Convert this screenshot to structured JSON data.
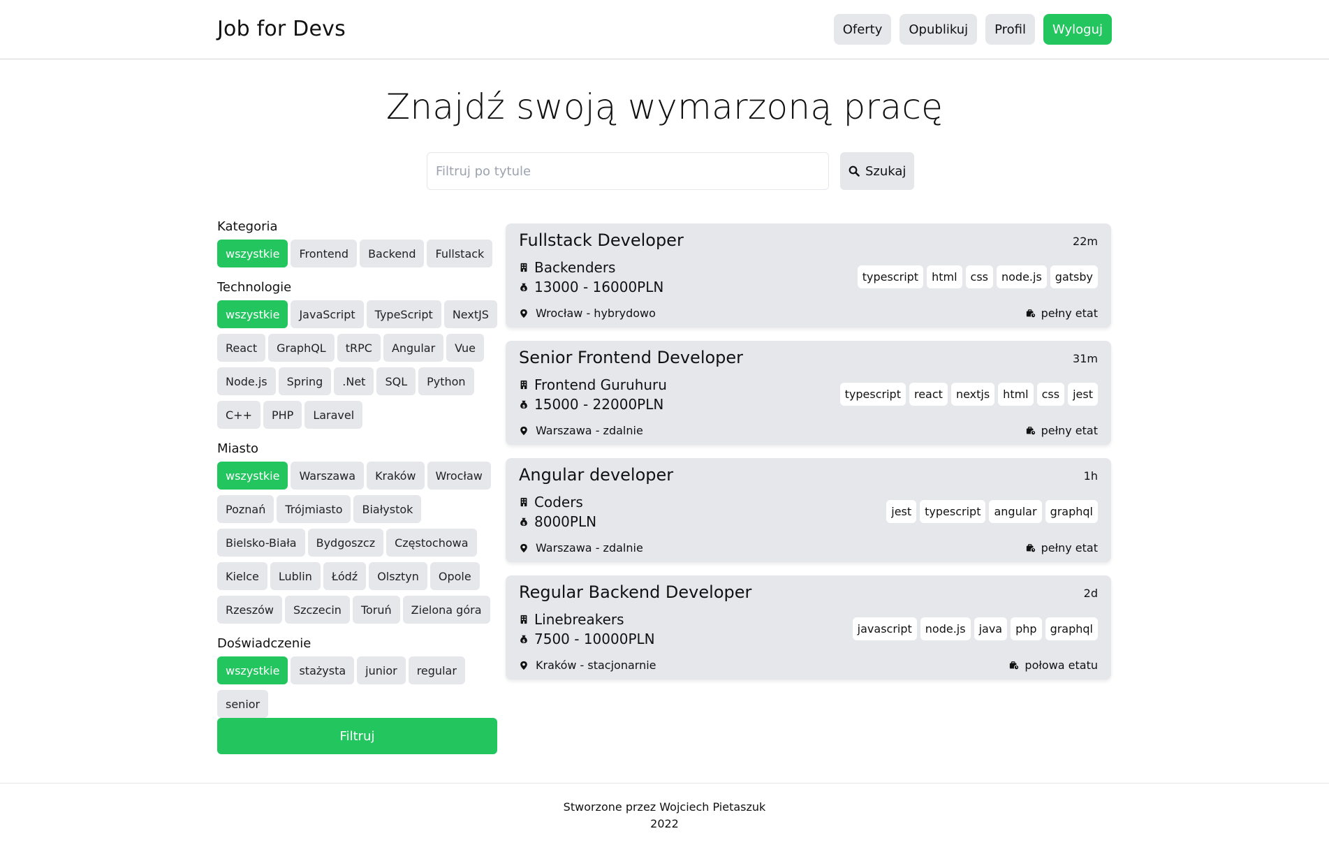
{
  "header": {
    "brand": "Job for Devs",
    "nav": [
      {
        "label": "Oferty",
        "name": "nav-oferty-button"
      },
      {
        "label": "Opublikuj",
        "name": "nav-opublikuj-button"
      },
      {
        "label": "Profil",
        "name": "nav-profil-button"
      },
      {
        "label": "Wyloguj",
        "name": "nav-wyloguj-button"
      }
    ]
  },
  "hero": {
    "title": "Znajdź swoją wymarzoną pracę"
  },
  "search": {
    "placeholder": "Filtruj po tytule",
    "value": "",
    "button_label": "Szukaj"
  },
  "filters": {
    "category": {
      "heading": "Kategoria",
      "options": [
        "wszystkie",
        "Frontend",
        "Backend",
        "Fullstack"
      ],
      "selected": "wszystkie"
    },
    "technology": {
      "heading": "Technologie",
      "options": [
        "wszystkie",
        "JavaScript",
        "TypeScript",
        "NextJS",
        "React",
        "GraphQL",
        "tRPC",
        "Angular",
        "Vue",
        "Node.js",
        "Spring",
        ".Net",
        "SQL",
        "Python",
        "C++",
        "PHP",
        "Laravel"
      ],
      "selected": "wszystkie"
    },
    "city": {
      "heading": "Miasto",
      "options": [
        "wszystkie",
        "Warszawa",
        "Kraków",
        "Wrocław",
        "Poznań",
        "Trójmiasto",
        "Białystok",
        "Bielsko-Biała",
        "Bydgoszcz",
        "Częstochowa",
        "Kielce",
        "Lublin",
        "Łódź",
        "Olsztyn",
        "Opole",
        "Rzeszów",
        "Szczecin",
        "Toruń",
        "Zielona góra"
      ],
      "selected": "wszystkie"
    },
    "experience": {
      "heading": "Doświadczenie",
      "options": [
        "wszystkie",
        "stażysta",
        "junior",
        "regular",
        "senior"
      ],
      "selected": "wszystkie"
    },
    "submit_label": "Filtruj"
  },
  "jobs": [
    {
      "title": "Fullstack Developer",
      "age": "22m",
      "company": "Backenders",
      "salary": "13000 - 16000PLN",
      "location": "Wrocław - hybrydowo",
      "employment": "pełny etat",
      "tags": [
        "typescript",
        "html",
        "css",
        "node.js",
        "gatsby"
      ]
    },
    {
      "title": "Senior Frontend Developer",
      "age": "31m",
      "company": "Frontend Guruhuru",
      "salary": "15000 - 22000PLN",
      "location": "Warszawa - zdalnie",
      "employment": "pełny etat",
      "tags": [
        "typescript",
        "react",
        "nextjs",
        "html",
        "css",
        "jest"
      ]
    },
    {
      "title": "Angular developer",
      "age": "1h",
      "company": "Coders",
      "salary": "8000PLN",
      "location": "Warszawa - zdalnie",
      "employment": "pełny etat",
      "tags": [
        "jest",
        "typescript",
        "angular",
        "graphql"
      ]
    },
    {
      "title": "Regular Backend Developer",
      "age": "2d",
      "company": "Linebreakers",
      "salary": "7500 - 10000PLN",
      "location": "Kraków - stacjonarnie",
      "employment": "połowa etatu",
      "tags": [
        "javascript",
        "node.js",
        "java",
        "php",
        "graphql"
      ]
    }
  ],
  "footer": {
    "credit": "Stworzone przez Wojciech Pietaszuk",
    "year": "2022"
  },
  "colors": {
    "accent": "#22c55e",
    "chip_bg": "#e5e7eb",
    "card_bg": "#e5e7eb"
  },
  "icons": {
    "search": "search-icon",
    "company": "building-icon",
    "salary": "money-bag-icon",
    "location": "map-pin-icon",
    "employment": "briefcase-clock-icon"
  }
}
